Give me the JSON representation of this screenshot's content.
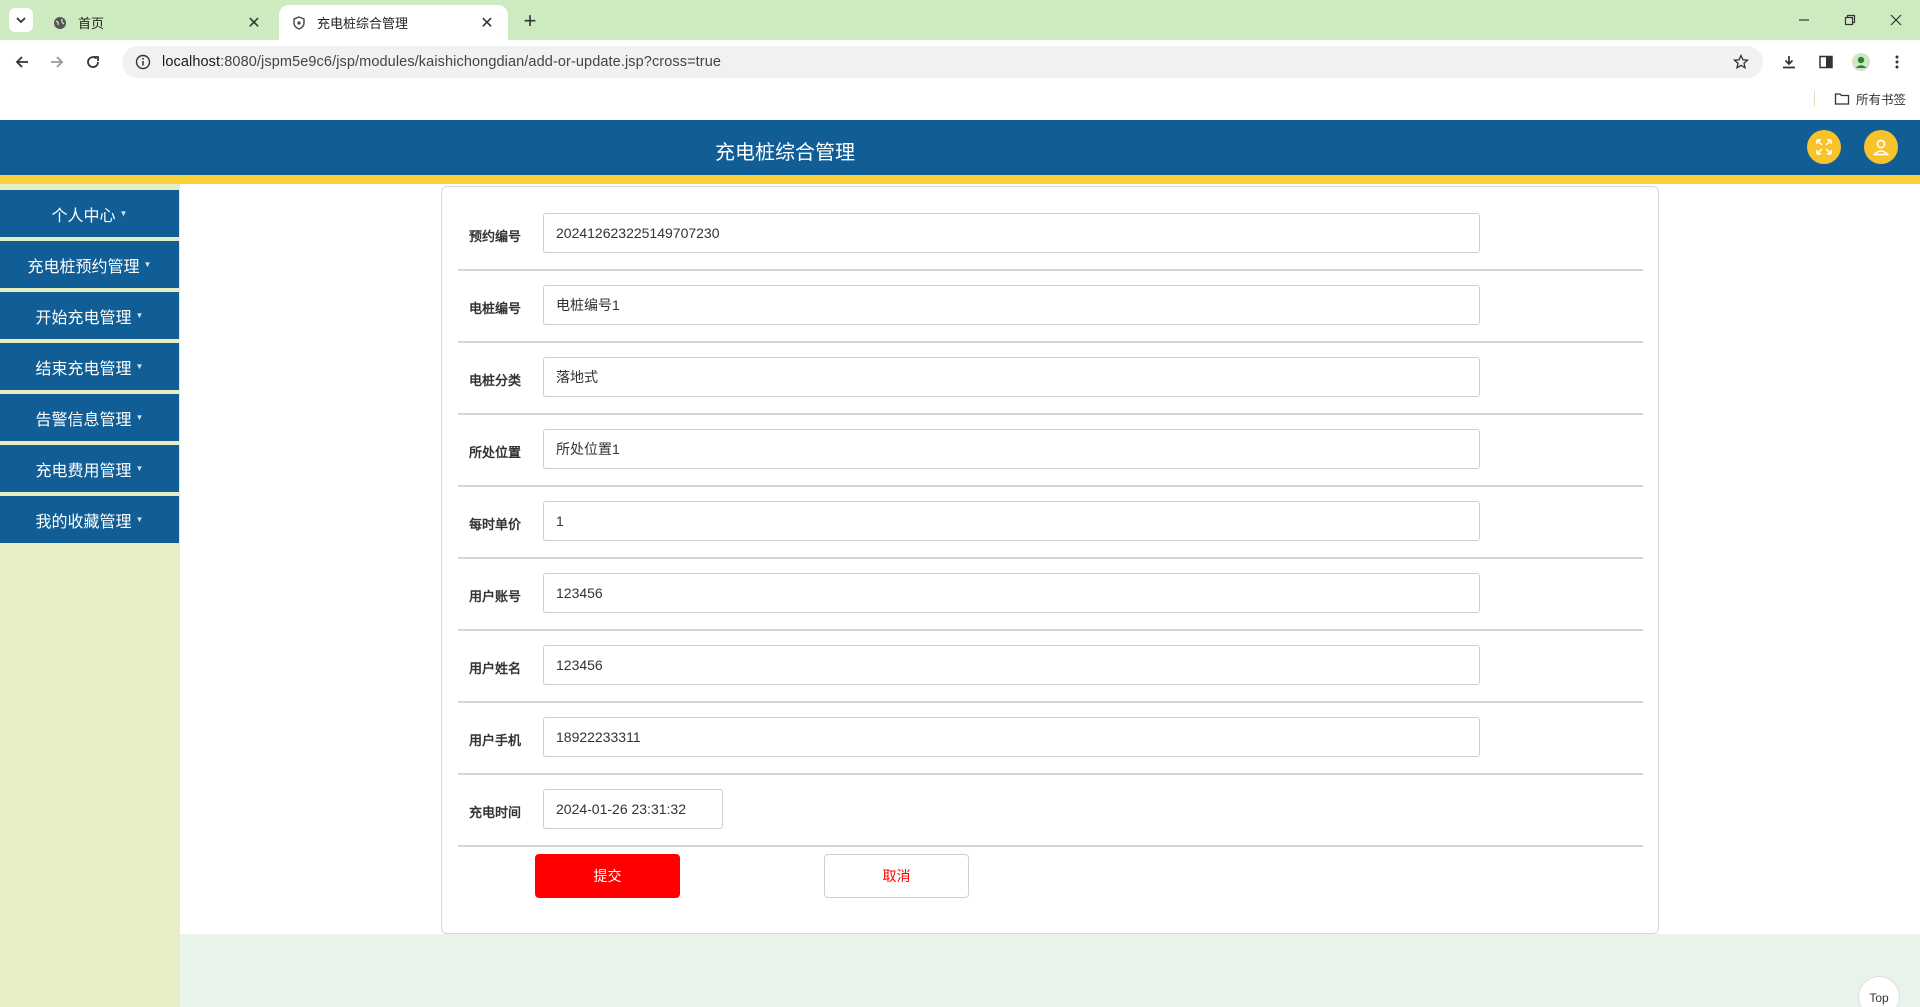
{
  "browser": {
    "tabs": [
      {
        "title": "首页",
        "icon": "globe-icon",
        "active": false
      },
      {
        "title": "充电桩综合管理",
        "icon": "shield-icon",
        "active": true
      }
    ],
    "url_host": "localhost",
    "url_rest": ":8080/jspm5e9c6/jsp/modules/kaishichongdian/add-or-update.jsp?cross=true",
    "bookmarks_all": "所有书签"
  },
  "header": {
    "title": "充电桩综合管理"
  },
  "sidebar": {
    "items": [
      {
        "label": "个人中心"
      },
      {
        "label": "充电桩预约管理"
      },
      {
        "label": "开始充电管理"
      },
      {
        "label": "结束充电管理"
      },
      {
        "label": "告警信息管理"
      },
      {
        "label": "充电费用管理"
      },
      {
        "label": "我的收藏管理"
      }
    ]
  },
  "form": {
    "fields": [
      {
        "label": "预约编号",
        "value": "202412623225149707230"
      },
      {
        "label": "电桩编号",
        "value": "电桩编号1"
      },
      {
        "label": "电桩分类",
        "value": "落地式"
      },
      {
        "label": "所处位置",
        "value": "所处位置1"
      },
      {
        "label": "每时单价",
        "value": "1"
      },
      {
        "label": "用户账号",
        "value": "123456"
      },
      {
        "label": "用户姓名",
        "value": "123456"
      },
      {
        "label": "用户手机",
        "value": "18922233311"
      },
      {
        "label": "充电时间",
        "value": "2024-01-26 23:31:32"
      }
    ],
    "submit_label": "提交",
    "cancel_label": "取消"
  },
  "top_button": "Top",
  "colors": {
    "header_bg": "#115e96",
    "accent_yellow": "#f9d03a",
    "submit_red": "#ff0000",
    "sidebar_bg": "#e9edc6",
    "tabstrip_bg": "#cdeac0"
  }
}
